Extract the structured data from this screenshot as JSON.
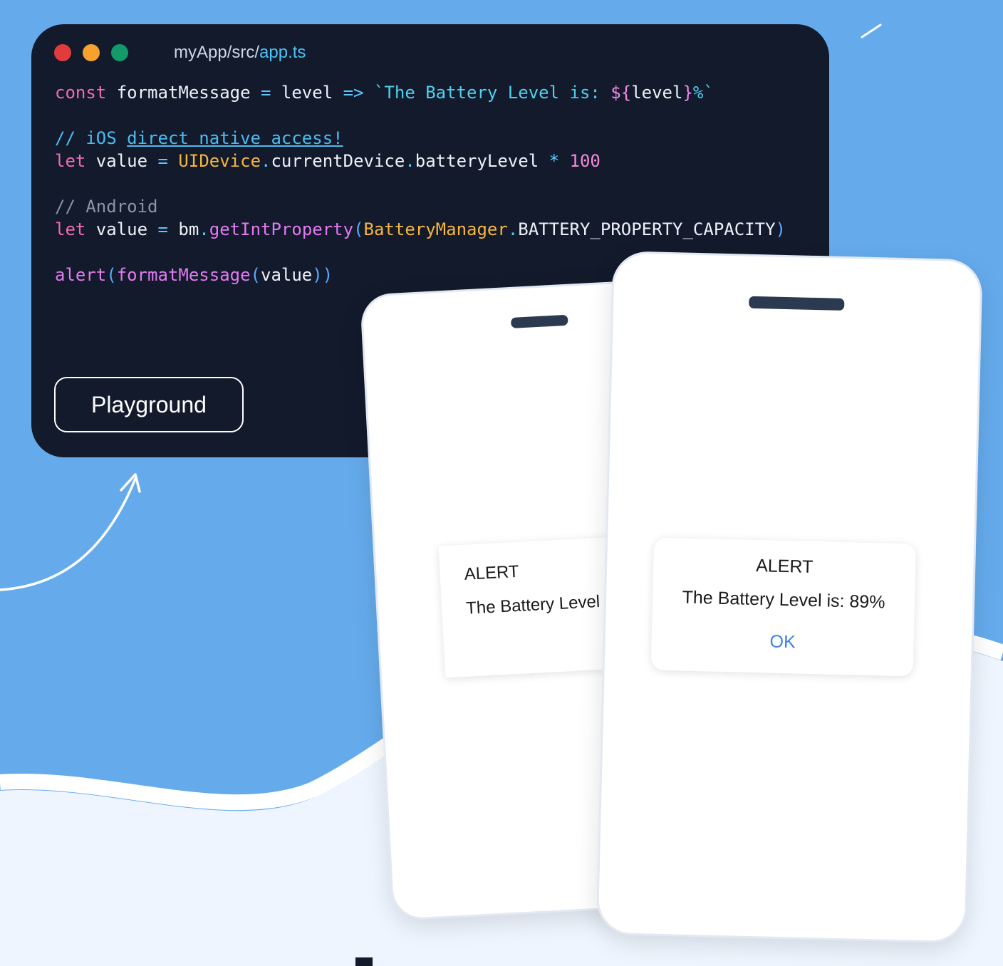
{
  "colors": {
    "background_blue": "#65abec",
    "lower_background": "#eef5fe",
    "code_background": "#121a2c",
    "traffic_red": "#e23b3b",
    "traffic_orange": "#f6a22d",
    "traffic_green": "#129a68",
    "alert_ok_blue": "#3b82e6"
  },
  "code_window": {
    "path_prefix": "myApp/src/",
    "file_name": "app.ts",
    "lines": {
      "l1": {
        "kw": "const",
        "name": " formatMessage ",
        "eq": "=",
        "param": " level ",
        "arrow": "=>",
        "str_start": " `The Battery Level is: ",
        "interp_open": "${",
        "interp_var": "level",
        "interp_close": "}",
        "str_end": "%`"
      },
      "l2": {
        "comment_prefix": "// iOS ",
        "comment_link": "direct native access!"
      },
      "l3": {
        "kw": "let",
        "name": " value ",
        "eq": "=",
        "space": " ",
        "cls": "UIDevice",
        "dot1": ".",
        "prop1": "currentDevice",
        "dot2": ".",
        "prop2": "batteryLevel ",
        "op": "*",
        "num": " 100"
      },
      "l4": {
        "comment": "// Android"
      },
      "l5": {
        "kw": "let",
        "name": " value ",
        "eq": "=",
        "obj": " bm",
        "dot1": ".",
        "method": "getIntProperty",
        "paren_open": "(",
        "cls": "BatteryManager",
        "dot2": ".",
        "constant": "BATTERY_PROPERTY_CAPACITY",
        "paren_close": ")"
      },
      "l6": {
        "fn": "alert",
        "paren1": "(",
        "fn2": "formatMessage",
        "paren2": "(",
        "arg": "value",
        "close": "))"
      }
    },
    "playground_label": "Playground"
  },
  "phone_back": {
    "alert_title": "ALERT",
    "alert_message": "The Battery Level is:"
  },
  "phone_front": {
    "alert_title": "ALERT",
    "alert_message": "The Battery Level is: 89%",
    "ok_label": "OK"
  },
  "icons": [
    "traffic-light-red-icon",
    "traffic-light-orange-icon",
    "traffic-light-green-icon",
    "curved-arrow-icon"
  ]
}
